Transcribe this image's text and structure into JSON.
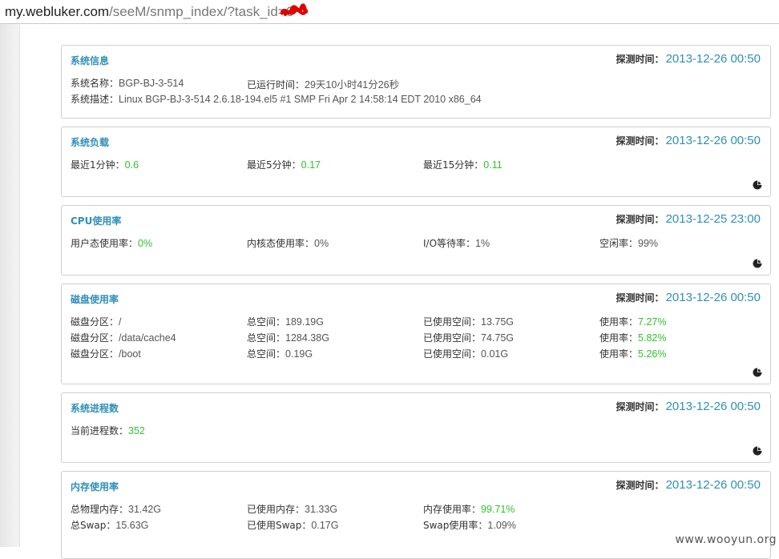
{
  "browser": {
    "url_host": "my.webluker.com",
    "url_path": "/seeM/snmp_index/?task_id=6"
  },
  "time_label": "探测时间：",
  "panels": {
    "sysinfo": {
      "title": "系统信息",
      "time": "2013-12-26 00:50",
      "name_label": "系统名称：",
      "name_value": "BGP-BJ-3-514",
      "uptime_label": "已运行时间：",
      "uptime_value": "29天10小时41分26秒",
      "desc_label": "系统描述：",
      "desc_value": "Linux BGP-BJ-3-514 2.6.18-194.el5 #1 SMP Fri Apr 2 14:58:14 EDT 2010 x86_64"
    },
    "load": {
      "title": "系统负载",
      "time": "2013-12-26 00:50",
      "items": [
        {
          "label": "最近1分钟：",
          "value": "0.6"
        },
        {
          "label": "最近5分钟：",
          "value": "0.17"
        },
        {
          "label": "最近15分钟：",
          "value": "0.11"
        }
      ]
    },
    "cpu": {
      "title": "CPU使用率",
      "time": "2013-12-25 23:00",
      "items": [
        {
          "label": "用户态使用率：",
          "value": "0%"
        },
        {
          "label": "内核态使用率：",
          "value": "0%"
        },
        {
          "label": "I/O等待率：",
          "value": "1%"
        },
        {
          "label": "空闲率：",
          "value": "99%"
        }
      ]
    },
    "disk": {
      "title": "磁盘使用率",
      "time": "2013-12-26 00:50",
      "partition_label": "磁盘分区：",
      "total_label": "总空间：",
      "used_label": "已使用空间：",
      "rate_label": "使用率：",
      "rows": [
        {
          "partition": "/",
          "total": "189.19G",
          "used": "13.75G",
          "rate": "7.27%"
        },
        {
          "partition": "/data/cache4",
          "total": "1284.38G",
          "used": "74.75G",
          "rate": "5.82%"
        },
        {
          "partition": "/boot",
          "total": "0.19G",
          "used": "0.01G",
          "rate": "5.26%"
        }
      ]
    },
    "proc": {
      "title": "系统进程数",
      "time": "2013-12-26 00:50",
      "label": "当前进程数：",
      "value": "352"
    },
    "mem": {
      "title": "内存使用率",
      "time": "2013-12-26 00:50",
      "phys_label": "总物理内存：",
      "phys_value": "31.42G",
      "used_label": "已使用内存：",
      "used_value": "31.33G",
      "rate_label": "内存使用率：",
      "rate_value": "99.71%",
      "swap_label": "总Swap：",
      "swap_value": "15.63G",
      "swap_used_label": "已使用Swap：",
      "swap_used_value": "0.17G",
      "swap_rate_label": "Swap使用率：",
      "swap_rate_value": "1.09%"
    }
  },
  "watermark": "www.wooyun.org",
  "colors": {
    "title_blue": "#2f8fb8",
    "value_green": "#2fc22f"
  }
}
